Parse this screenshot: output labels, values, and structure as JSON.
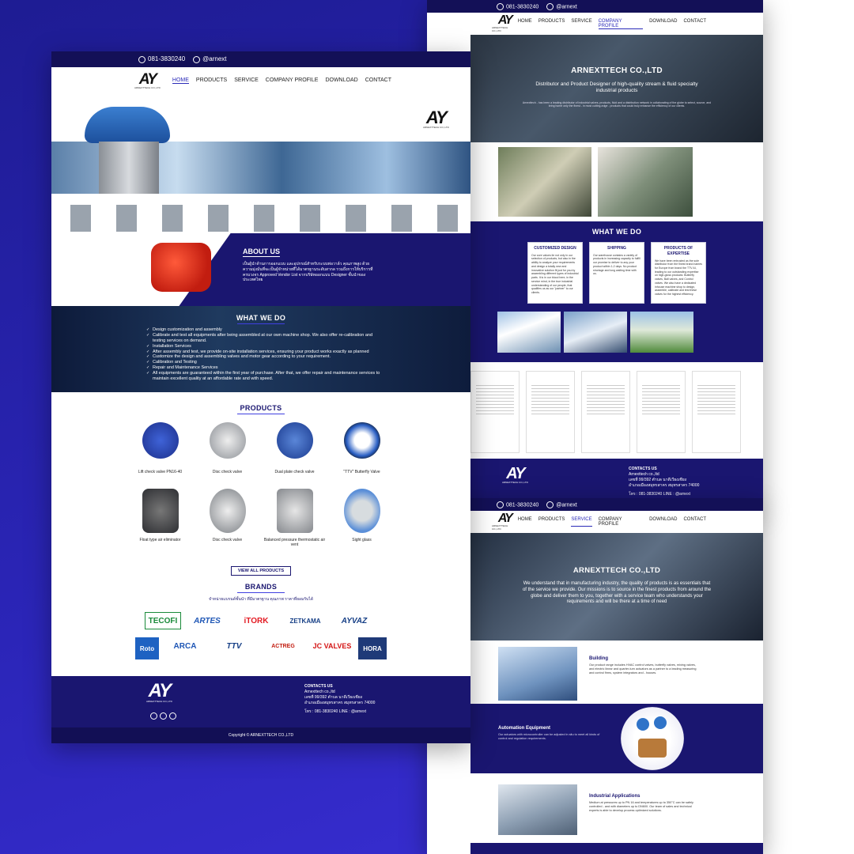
{
  "common": {
    "phone": "081-3830240",
    "line_id": "@arnext",
    "logo_mark": "AY",
    "logo_name": "ARNEXTTECH CO.,LTD",
    "menu": [
      "HOME",
      "PRODUCTS",
      "SERVICE",
      "COMPANY PROFILE",
      "DOWNLOAD",
      "CONTACT"
    ]
  },
  "left": {
    "active_menu": "HOME",
    "about_title": "ABOUT US",
    "about_text": "เป็นผู้นำด้านการออกแบบ และอุปกรณ์สำหรับระบบท่อวาล์ว คุณภาพสูง ด้วยความมุ่งมั่นที่จะเป็นผู้จำหน่ายที่ได้มาตรฐานระดับสากล รวมถึงการให้บริการที่ครบวงจร Approved Vendor List จากบริษัทออกแบบ Designer ชั้นนำของประเทศไทย",
    "whatwedo_title": "WHAT WE DO",
    "whatwedo_items": [
      "Design customization and assembly",
      "Calibrate and test all equipments after being assembled at our own machine shop. We also offer re-calibration and testing services on demand.",
      "Installation Services",
      "After assembly and test, we provide on-site installation services, ensuring your product works exactly as planned",
      "Customize the design and assembling valves and motor gear according to your requirement.",
      "Calibration and Testing",
      "Repair and Maintenance Services",
      "All equipments are guaranteed within the first year of purchase. After that, we offer repair and maintenance services to maintain excellent quality at an affordable rate and with speed."
    ],
    "products_title": "PRODUCTS",
    "products": [
      "Lift check valve PN16-40",
      "Disc check valve",
      "Dual plate check valve",
      "\"TTV\" Butterfly Valve",
      "Float type air eliminator",
      "Disc check valve",
      "Balanced pressure thermostatic air vent",
      "Sight glass"
    ],
    "view_all": "VIEW ALL PRODUCTS",
    "brands_title": "BRANDS",
    "brands_sub": "จำหน่ายแบรนด์ชั้นนำ ที่มีมาตรฐาน คุณภาพ ราคาที่ยอมรับได้",
    "brands": [
      "TECOFI",
      "ARTES",
      "iTORK",
      "ZETKAMA",
      "AYVAZ",
      "Roto",
      "ARCA",
      "TTV",
      "ACTREG",
      "JC VALVES",
      "HORA"
    ],
    "contact_title": "CONTACTS US",
    "contact_lines": [
      "Arnexttech co.,ltd",
      "เลขที่ 99/392 ตำบล นาดีเวียงเชียง",
      "อำเภอเมืองสมุทรสาคร สมุทรสาคร 74000"
    ],
    "contact_tel": "โทร : 081-3830240 LINE : @arnext",
    "copyright": "Copyright © ARNEXTTECH CO.,LTD"
  },
  "right_top": {
    "active_menu": "COMPANY PROFILE",
    "hero_title": "ARNEXTTECH CO.,LTD",
    "hero_sub": "Distributor and Product Designer of high-quality stream & fluid specialty industrial products",
    "hero_text": "Arnexttech - has been a leading distributor of industrial valves, products, fluid and a distribution network in collaborating of the globe to select, source, and bring home only the finest - in most cutting-edge - products that could truly enhance the efficiency of our clients.",
    "whatwedo_title": "WHAT WE DO",
    "cards": [
      {
        "title": "CUSTOMIZED DESIGN",
        "text": "Our core values lie not only in our selection of products, but also in the ability to analyze your requirements and design a totally new and innovative solution fit just for you by assembling different types of industrial parts. It is in our blood here, in the service mind, in the true industrial understanding of our people, that qualifies us as our \"partner\" to our clients."
      },
      {
        "title": "SHIPPING",
        "text": "Our warehouse contains a variety of products in increasing capacity to fulfill our promise to deliver to any your product within 1-2 days. No product shortage and long waiting time with us."
      },
      {
        "title": "PRODUCTS OF EXPERTISE",
        "text": "We have been entrusted as the sole distributor from the finest brand names for Europe from brand the TTV AI, leading to our outstanding expertise on high-gloss products: Butterfly valves, Ball valves, and Control valves. We also have a dedicated inhouse machine shop to design, assemble, calibrate and test these valves for the highest efficiency."
      }
    ],
    "contact_title": "CONTACTS US",
    "contact_lines": [
      "Arnexttech co.,ltd",
      "เลขที่ 99/392 ตำบล นาดีเวียงเชียง",
      "อำเภอเมืองสมุทรสาคร สมุทรสาคร 74000"
    ],
    "contact_tel": "โทร : 081-3830240 LINE : @arnext"
  },
  "right_bottom": {
    "active_menu": "SERVICE",
    "hero_title": "ARNEXTTECH CO.,LTD",
    "hero_text": "We understand that in manufacturing industry, the quality of products is as essentials that of the service we provide. Our missions is to source in the finest products from around the globe and deliver them to you, together with a service team who understands your requirements and will be there at a time of need",
    "sections": [
      {
        "title": "Building",
        "text": "Our product range includes HVAC control valves, butterfly valves, mixing valves, and electric linear and quarter-turn actuators as a partner to a leading measuring and control firms, system integrators and - houses."
      },
      {
        "title": "Automation Equipment",
        "text": "Our actuators with microcontroller can be adjusted in situ to meet all kinds of control and regulation requirements."
      },
      {
        "title": "Industrial Applications",
        "text": "Medium at pressures up to PN 16 and temperatures up to 350°C can be safely controlled - and with diameters up to DN600. Our team of sales and technical experts is able to develop process optimized solutions."
      }
    ]
  }
}
